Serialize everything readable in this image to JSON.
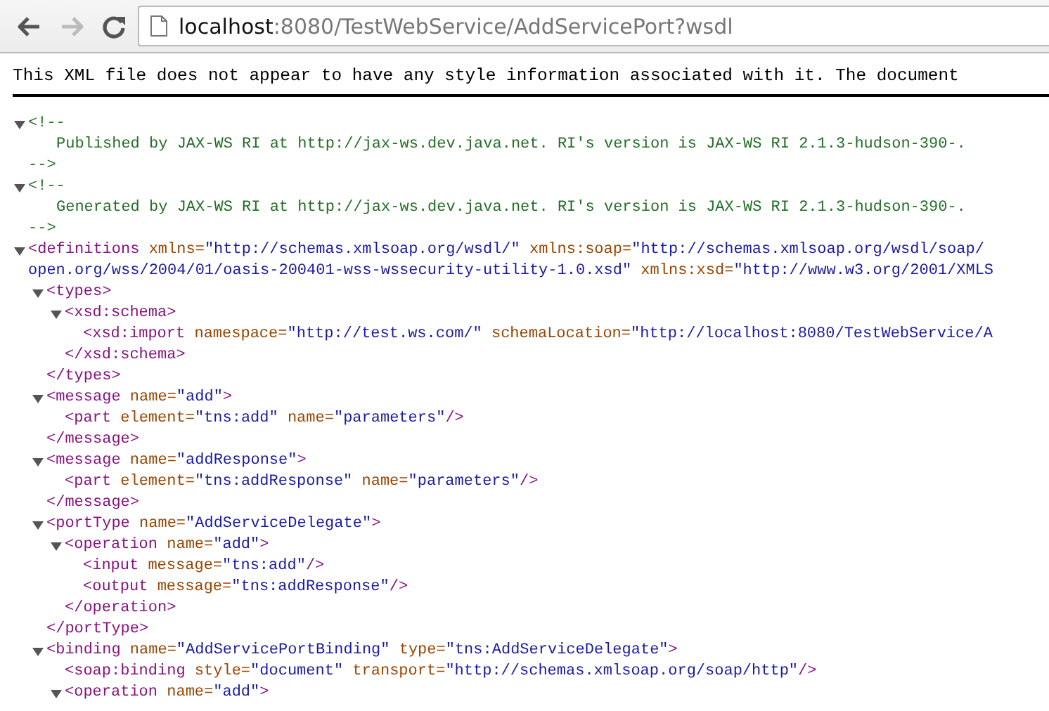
{
  "nav": [
    {
      "kind": "back",
      "disabled": false
    },
    {
      "kind": "forward",
      "disabled": true
    },
    {
      "kind": "reload",
      "disabled": false
    }
  ],
  "address": {
    "host": "localhost",
    "rest": ":8080/TestWebService/AddServicePort?wsdl"
  },
  "notice": "This XML file does not appear to have any style information associated with it. The document",
  "tree": [
    {
      "kind": "comment",
      "expanded": true,
      "open": "<!--",
      "body": "Published by JAX-WS RI at http://jax-ws.dev.java.net. RI's version is JAX-WS RI 2.1.3-hudson-390-.",
      "close": "-->"
    },
    {
      "kind": "comment",
      "expanded": true,
      "open": "<!--",
      "body": "Generated by JAX-WS RI at http://jax-ws.dev.java.net. RI's version is JAX-WS RI 2.1.3-hudson-390-.",
      "close": "-->"
    },
    {
      "kind": "element",
      "expanded": true,
      "open": [
        [
          {
            "kind": "tag",
            "text": "<definitions"
          },
          {
            "kind": "attr",
            "text": " xmlns="
          },
          {
            "kind": "value",
            "text": "\"http://schemas.xmlsoap.org/wsdl/\""
          },
          {
            "kind": "attr",
            "text": " xmlns:soap="
          },
          {
            "kind": "value",
            "text": "\"http://schemas.xmlsoap.org/wsdl/soap/"
          }
        ],
        [
          {
            "kind": "value",
            "text": "open.org/wss/2004/01/oasis-200401-wss-wssecurity-utility-1.0.xsd\""
          },
          {
            "kind": "attr",
            "text": " xmlns:xsd="
          },
          {
            "kind": "value",
            "text": "\"http://www.w3.org/2001/XMLS"
          }
        ]
      ],
      "children": [
        {
          "kind": "element",
          "expanded": true,
          "open": [
            [
              {
                "kind": "tag",
                "text": "<types>"
              }
            ]
          ],
          "children": [
            {
              "kind": "element",
              "expanded": true,
              "open": [
                [
                  {
                    "kind": "tag",
                    "text": "<xsd:schema>"
                  }
                ]
              ],
              "children": [
                {
                  "kind": "leaf",
                  "open": [
                    [
                      {
                        "kind": "tag",
                        "text": "<xsd:import"
                      },
                      {
                        "kind": "attr",
                        "text": " namespace="
                      },
                      {
                        "kind": "value",
                        "text": "\"http://test.ws.com/\""
                      },
                      {
                        "kind": "attr",
                        "text": " schemaLocation="
                      },
                      {
                        "kind": "value",
                        "text": "\"http://localhost:8080/TestWebService/A"
                      }
                    ]
                  ]
                }
              ],
              "close": "</xsd:schema>"
            }
          ],
          "close": "</types>"
        },
        {
          "kind": "element",
          "expanded": true,
          "open": [
            [
              {
                "kind": "tag",
                "text": "<message"
              },
              {
                "kind": "attr",
                "text": " name="
              },
              {
                "kind": "value",
                "text": "\"add\""
              },
              {
                "kind": "tag",
                "text": ">"
              }
            ]
          ],
          "children": [
            {
              "kind": "leaf",
              "open": [
                [
                  {
                    "kind": "tag",
                    "text": "<part"
                  },
                  {
                    "kind": "attr",
                    "text": " element="
                  },
                  {
                    "kind": "value",
                    "text": "\"tns:add\""
                  },
                  {
                    "kind": "attr",
                    "text": " name="
                  },
                  {
                    "kind": "value",
                    "text": "\"parameters\""
                  },
                  {
                    "kind": "tag",
                    "text": "/>"
                  }
                ]
              ]
            }
          ],
          "close": "</message>"
        },
        {
          "kind": "element",
          "expanded": true,
          "open": [
            [
              {
                "kind": "tag",
                "text": "<message"
              },
              {
                "kind": "attr",
                "text": " name="
              },
              {
                "kind": "value",
                "text": "\"addResponse\""
              },
              {
                "kind": "tag",
                "text": ">"
              }
            ]
          ],
          "children": [
            {
              "kind": "leaf",
              "open": [
                [
                  {
                    "kind": "tag",
                    "text": "<part"
                  },
                  {
                    "kind": "attr",
                    "text": " element="
                  },
                  {
                    "kind": "value",
                    "text": "\"tns:addResponse\""
                  },
                  {
                    "kind": "attr",
                    "text": " name="
                  },
                  {
                    "kind": "value",
                    "text": "\"parameters\""
                  },
                  {
                    "kind": "tag",
                    "text": "/>"
                  }
                ]
              ]
            }
          ],
          "close": "</message>"
        },
        {
          "kind": "element",
          "expanded": true,
          "open": [
            [
              {
                "kind": "tag",
                "text": "<portType"
              },
              {
                "kind": "attr",
                "text": " name="
              },
              {
                "kind": "value",
                "text": "\"AddServiceDelegate\""
              },
              {
                "kind": "tag",
                "text": ">"
              }
            ]
          ],
          "children": [
            {
              "kind": "element",
              "expanded": true,
              "open": [
                [
                  {
                    "kind": "tag",
                    "text": "<operation"
                  },
                  {
                    "kind": "attr",
                    "text": " name="
                  },
                  {
                    "kind": "value",
                    "text": "\"add\""
                  },
                  {
                    "kind": "tag",
                    "text": ">"
                  }
                ]
              ],
              "children": [
                {
                  "kind": "leaf",
                  "open": [
                    [
                      {
                        "kind": "tag",
                        "text": "<input"
                      },
                      {
                        "kind": "attr",
                        "text": " message="
                      },
                      {
                        "kind": "value",
                        "text": "\"tns:add\""
                      },
                      {
                        "kind": "tag",
                        "text": "/>"
                      }
                    ]
                  ]
                },
                {
                  "kind": "leaf",
                  "open": [
                    [
                      {
                        "kind": "tag",
                        "text": "<output"
                      },
                      {
                        "kind": "attr",
                        "text": " message="
                      },
                      {
                        "kind": "value",
                        "text": "\"tns:addResponse\""
                      },
                      {
                        "kind": "tag",
                        "text": "/>"
                      }
                    ]
                  ]
                }
              ],
              "close": "</operation>"
            }
          ],
          "close": "</portType>"
        },
        {
          "kind": "element",
          "expanded": true,
          "open": [
            [
              {
                "kind": "tag",
                "text": "<binding"
              },
              {
                "kind": "attr",
                "text": " name="
              },
              {
                "kind": "value",
                "text": "\"AddServicePortBinding\""
              },
              {
                "kind": "attr",
                "text": " type="
              },
              {
                "kind": "value",
                "text": "\"tns:AddServiceDelegate\""
              },
              {
                "kind": "tag",
                "text": ">"
              }
            ]
          ],
          "children": [
            {
              "kind": "leaf",
              "open": [
                [
                  {
                    "kind": "tag",
                    "text": "<soap:binding"
                  },
                  {
                    "kind": "attr",
                    "text": " style="
                  },
                  {
                    "kind": "value",
                    "text": "\"document\""
                  },
                  {
                    "kind": "attr",
                    "text": " transport="
                  },
                  {
                    "kind": "value",
                    "text": "\"http://schemas.xmlsoap.org/soap/http\""
                  },
                  {
                    "kind": "tag",
                    "text": "/>"
                  }
                ]
              ]
            },
            {
              "kind": "element",
              "expanded": true,
              "open": [
                [
                  {
                    "kind": "tag",
                    "text": "<operation"
                  },
                  {
                    "kind": "attr",
                    "text": " name="
                  },
                  {
                    "kind": "value",
                    "text": "\"add\""
                  },
                  {
                    "kind": "tag",
                    "text": ">"
                  }
                ]
              ]
            }
          ]
        }
      ]
    }
  ]
}
